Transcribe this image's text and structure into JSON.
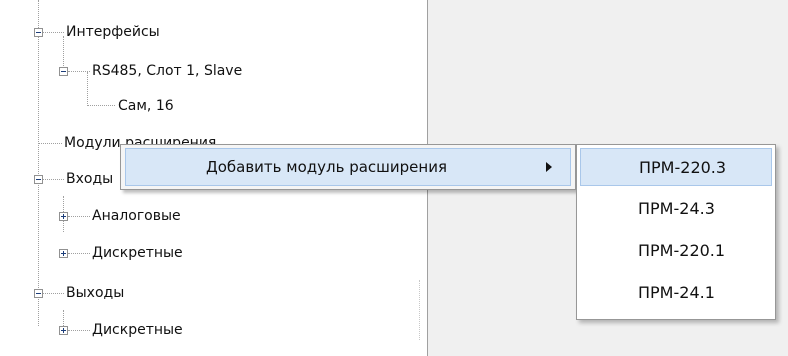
{
  "tree": {
    "interfaces": "Интерфейсы",
    "rs485": "RS485, Слот 1, Slave",
    "self_node": "Сам, 16",
    "expansion_modules": "Модули расширения",
    "inputs": "Входы",
    "analog": "Аналоговые",
    "inputs_discrete": "Дискретные",
    "outputs": "Выходы",
    "outputs_discrete": "Дискретные"
  },
  "context_menu": {
    "add_module_label": "Добавить модуль расширения"
  },
  "submenu": {
    "items": [
      "ПРМ-220.3",
      "ПРМ-24.3",
      "ПРМ-220.1",
      "ПРМ-24.1"
    ],
    "selected": "ПРМ-220.3"
  },
  "colors": {
    "highlight": "#d8e7f7",
    "highlight_border": "#a9c7ea",
    "menu_background": "#f5f5f5"
  },
  "icons": {
    "expand": "plus-box-icon",
    "collapse": "minus-box-icon",
    "submenu": "triangle-right-icon"
  }
}
